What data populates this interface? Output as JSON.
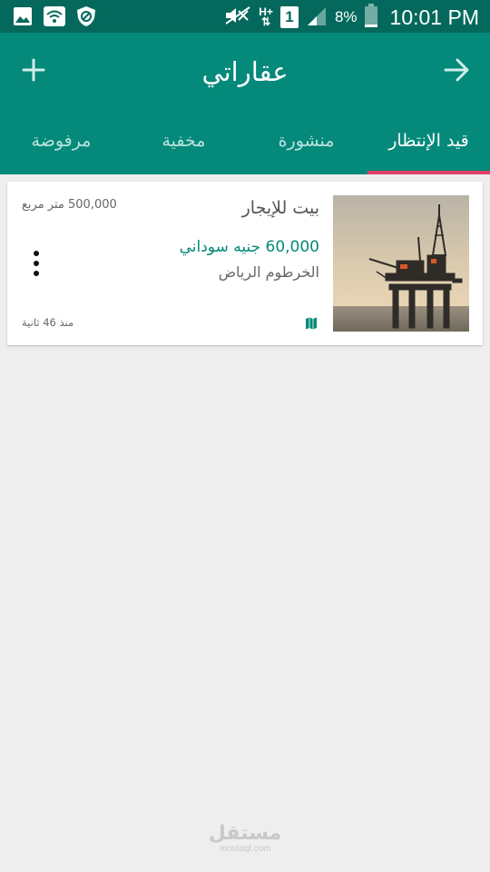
{
  "status_bar": {
    "time": "10:01 PM",
    "battery_percent": "8%",
    "network_type": "H+",
    "sim_slot": "1",
    "icons": [
      "gallery-icon",
      "wifi-icon",
      "vpn-shield-icon",
      "mute-icon",
      "signal-icon",
      "battery-icon"
    ]
  },
  "app_bar": {
    "title": "عقاراتي",
    "icons": {
      "add": "plus-icon",
      "back": "arrow-right-icon"
    },
    "colors": {
      "primary": "#05897a",
      "status": "#04695c",
      "indicator": "#e0426a"
    }
  },
  "tabs": [
    {
      "label": "قيد الإنتظار",
      "active": true
    },
    {
      "label": "منشورة",
      "active": false
    },
    {
      "label": "مخفية",
      "active": false
    },
    {
      "label": "مرفوضة",
      "active": false
    }
  ],
  "listings": [
    {
      "title": "بيت للإيجار",
      "price": "60,000 جنيه سوداني",
      "location": "الخرطوم الرياض",
      "area": "500,000 متر مربع",
      "posted": "منذ 46 ثانية",
      "image": "oil-platform-photo",
      "icons": {
        "menu": "more-vert-icon",
        "map": "map-icon"
      }
    }
  ],
  "watermark": {
    "ar": "مستقل",
    "en": "mostaql.com"
  }
}
